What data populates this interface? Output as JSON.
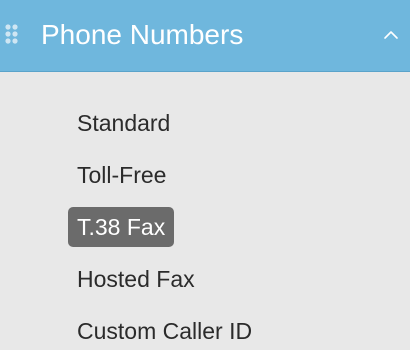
{
  "header": {
    "title": "Phone Numbers",
    "icon": "grid-icon",
    "toggle_icon": "chevron-up-icon"
  },
  "items": [
    {
      "label": "Standard",
      "active": false
    },
    {
      "label": "Toll-Free",
      "active": false
    },
    {
      "label": "T.38 Fax",
      "active": true
    },
    {
      "label": "Hosted Fax",
      "active": false
    },
    {
      "label": "Custom Caller ID",
      "active": false
    }
  ],
  "colors": {
    "header_bg": "#6fb7dd",
    "menu_bg": "#e8e8e8",
    "active_bg": "#6b6b6b",
    "text": "#2b2b2b"
  }
}
